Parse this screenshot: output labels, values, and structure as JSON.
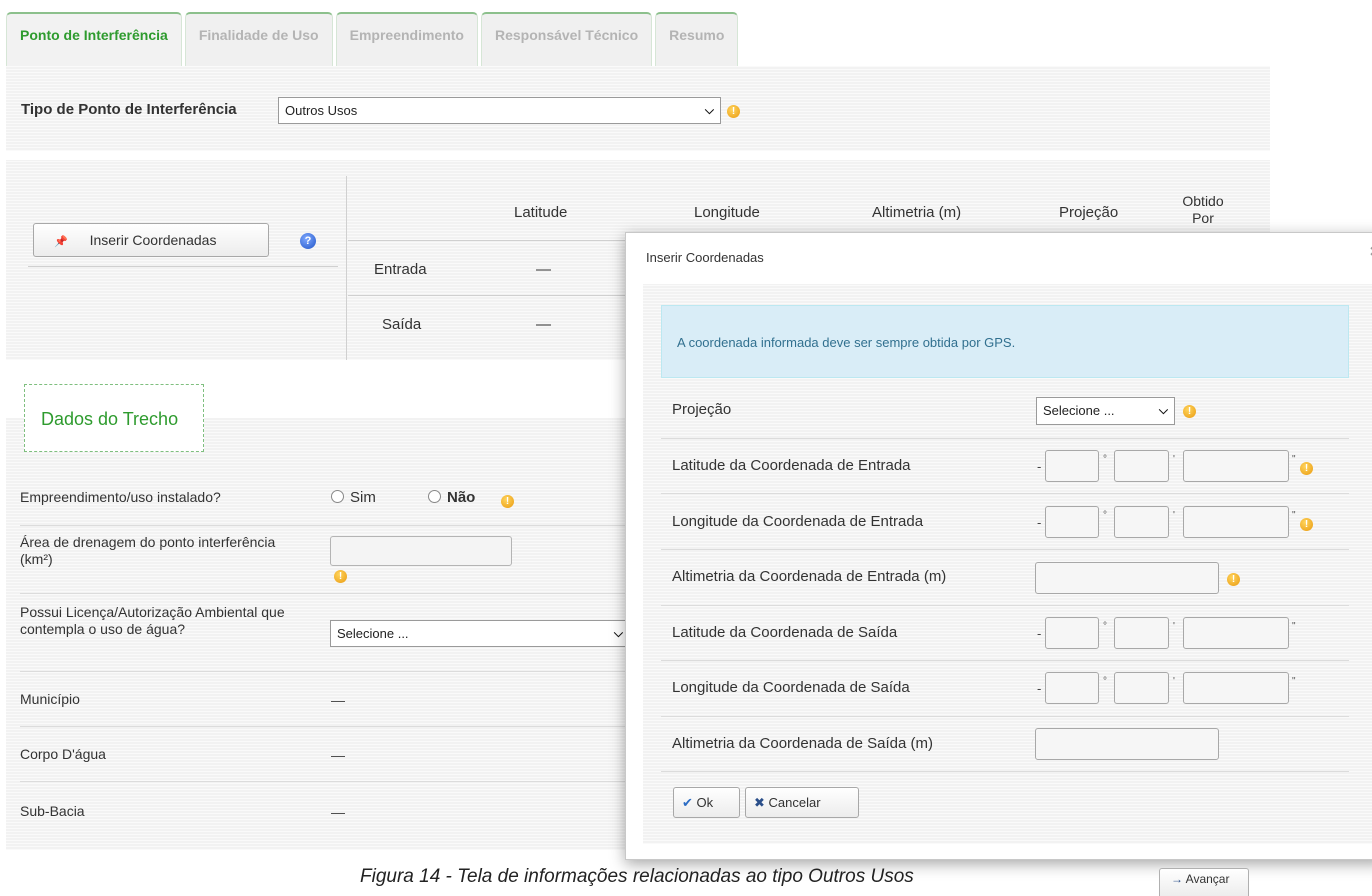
{
  "tabs": [
    {
      "label": "Ponto de Interferência"
    },
    {
      "label": "Finalidade de Uso"
    },
    {
      "label": "Empreendimento"
    },
    {
      "label": "Responsável Técnico"
    },
    {
      "label": "Resumo"
    }
  ],
  "tipo": {
    "label": "Tipo de Ponto de Interferência",
    "value": "Outros Usos"
  },
  "coords": {
    "insert_button": "Inserir Coordenadas",
    "headers": [
      "Latitude",
      "Longitude",
      "Altimetria (m)",
      "Projeção",
      "Obtido Por"
    ],
    "rows": [
      {
        "label": "Entrada",
        "latitude": "—"
      },
      {
        "label": "Saída",
        "latitude": "—"
      }
    ]
  },
  "trecho": {
    "title": "Dados do Trecho",
    "empreendimento_label": "Empreendimento/uso instalado?",
    "sim": "Sim",
    "nao": "Não",
    "area_label": "Área de drenagem do ponto interferência (km²)",
    "licenca_label": "Possui Licença/Autorização Ambiental que contempla o uso de água?",
    "licenca_value": "Selecione ...",
    "municipio_label": "Município",
    "municipio_value": "—",
    "corpo_label": "Corpo D'água",
    "corpo_value": "—",
    "subbacia_label": "Sub-Bacia",
    "subbacia_value": "—"
  },
  "modal": {
    "title": "Inserir Coordenadas",
    "alert": "A coordenada informada deve ser sempre obtida por GPS.",
    "projecao_label": "Projeção",
    "projecao_value": "Selecione ...",
    "lat_entrada": "Latitude da Coordenada de Entrada",
    "lon_entrada": "Longitude da Coordenada de Entrada",
    "alt_entrada": "Altimetria da Coordenada de Entrada (m)",
    "lat_saida": "Latitude da Coordenada de Saída",
    "lon_saida": "Longitude da Coordenada de Saída",
    "alt_saida": "Altimetria da Coordenada de Saída (m)",
    "ok": "Ok",
    "cancel": "Cancelar"
  },
  "caption": "Figura 14 - Tela de informações relacionadas ao tipo Outros Usos",
  "avancar": "Avançar",
  "icons": {
    "warning": "warning-icon",
    "help": "help-icon",
    "pin": "pin-icon",
    "check": "check-icon",
    "x": "x-icon",
    "arrow": "arrow-right-icon"
  }
}
